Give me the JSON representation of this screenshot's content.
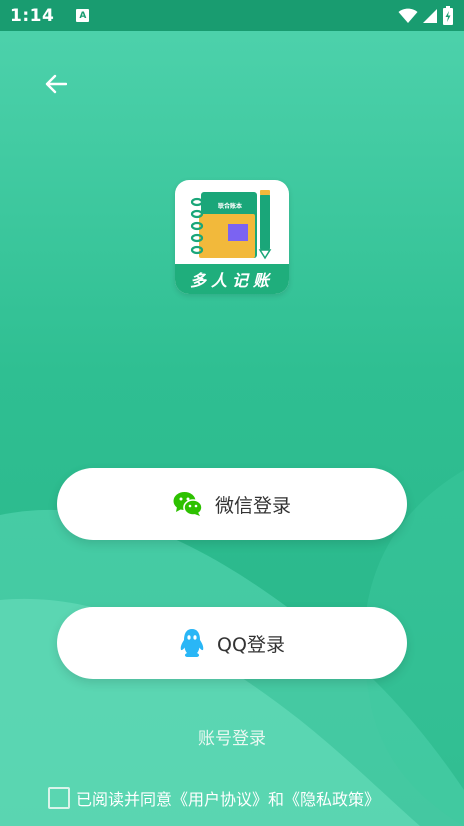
{
  "status_bar": {
    "time": "1:14",
    "notification_badge": "A"
  },
  "logo": {
    "app_name": "多人记账",
    "book_label": "联合账本"
  },
  "buttons": {
    "wechat_label": "微信登录",
    "qq_label": "QQ登录",
    "account_label": "账号登录"
  },
  "agreement": {
    "text": "已阅读并同意《用户协议》和《隐私政策》"
  },
  "colors": {
    "background": "#2fbf92",
    "status_bar": "#199c70",
    "wechat_green": "#2dc100",
    "qq_blue": "#29b6f6"
  }
}
